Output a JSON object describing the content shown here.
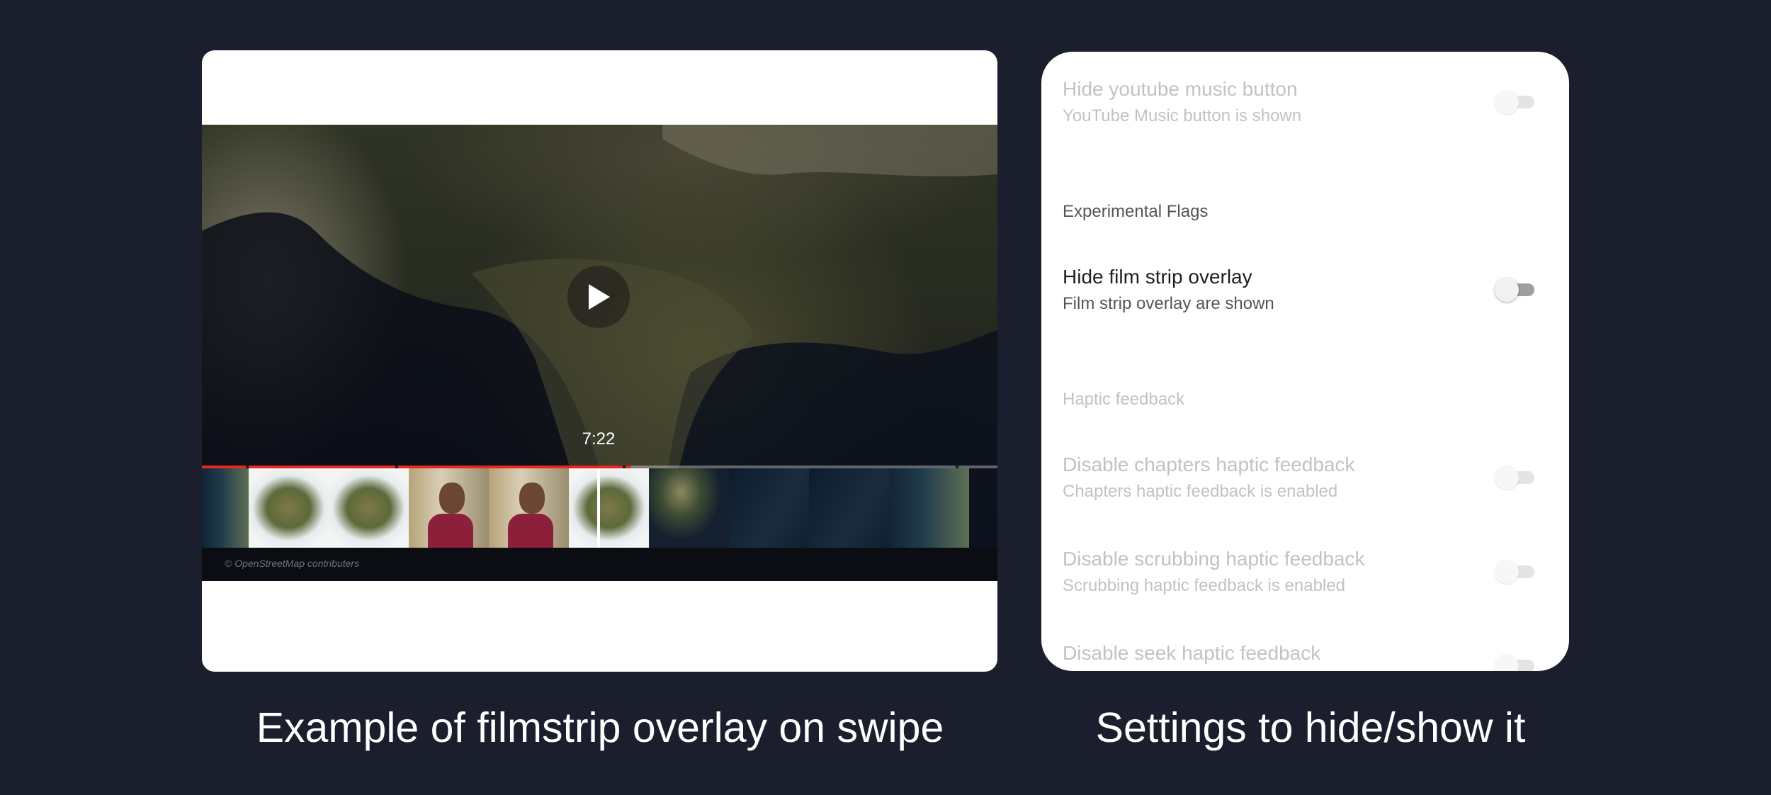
{
  "player": {
    "time": "7:22",
    "progress_fraction": 0.54,
    "attribution": "© OpenStreetMap contributers",
    "play_icon": "play-icon",
    "accent_color": "#e8271e"
  },
  "captions": {
    "left": "Example of filmstrip overlay on swipe",
    "right": "Settings to hide/show it"
  },
  "settings": {
    "items": [
      {
        "title": "Hide youtube music button",
        "summary": "YouTube Music button is shown",
        "enabled": false,
        "checked": false
      },
      {
        "title": "Hide film strip overlay",
        "summary": "Film strip overlay are shown",
        "enabled": true,
        "checked": false
      },
      {
        "title": "Disable chapters haptic feedback",
        "summary": "Chapters haptic feedback is enabled",
        "enabled": false,
        "checked": false
      },
      {
        "title": "Disable scrubbing haptic feedback",
        "summary": "Scrubbing haptic feedback is enabled",
        "enabled": false,
        "checked": false
      },
      {
        "title": "Disable seek haptic feedback",
        "summary": "",
        "enabled": false,
        "checked": false
      }
    ],
    "sections": {
      "experimental": "Experimental Flags",
      "haptic": "Haptic feedback"
    }
  }
}
